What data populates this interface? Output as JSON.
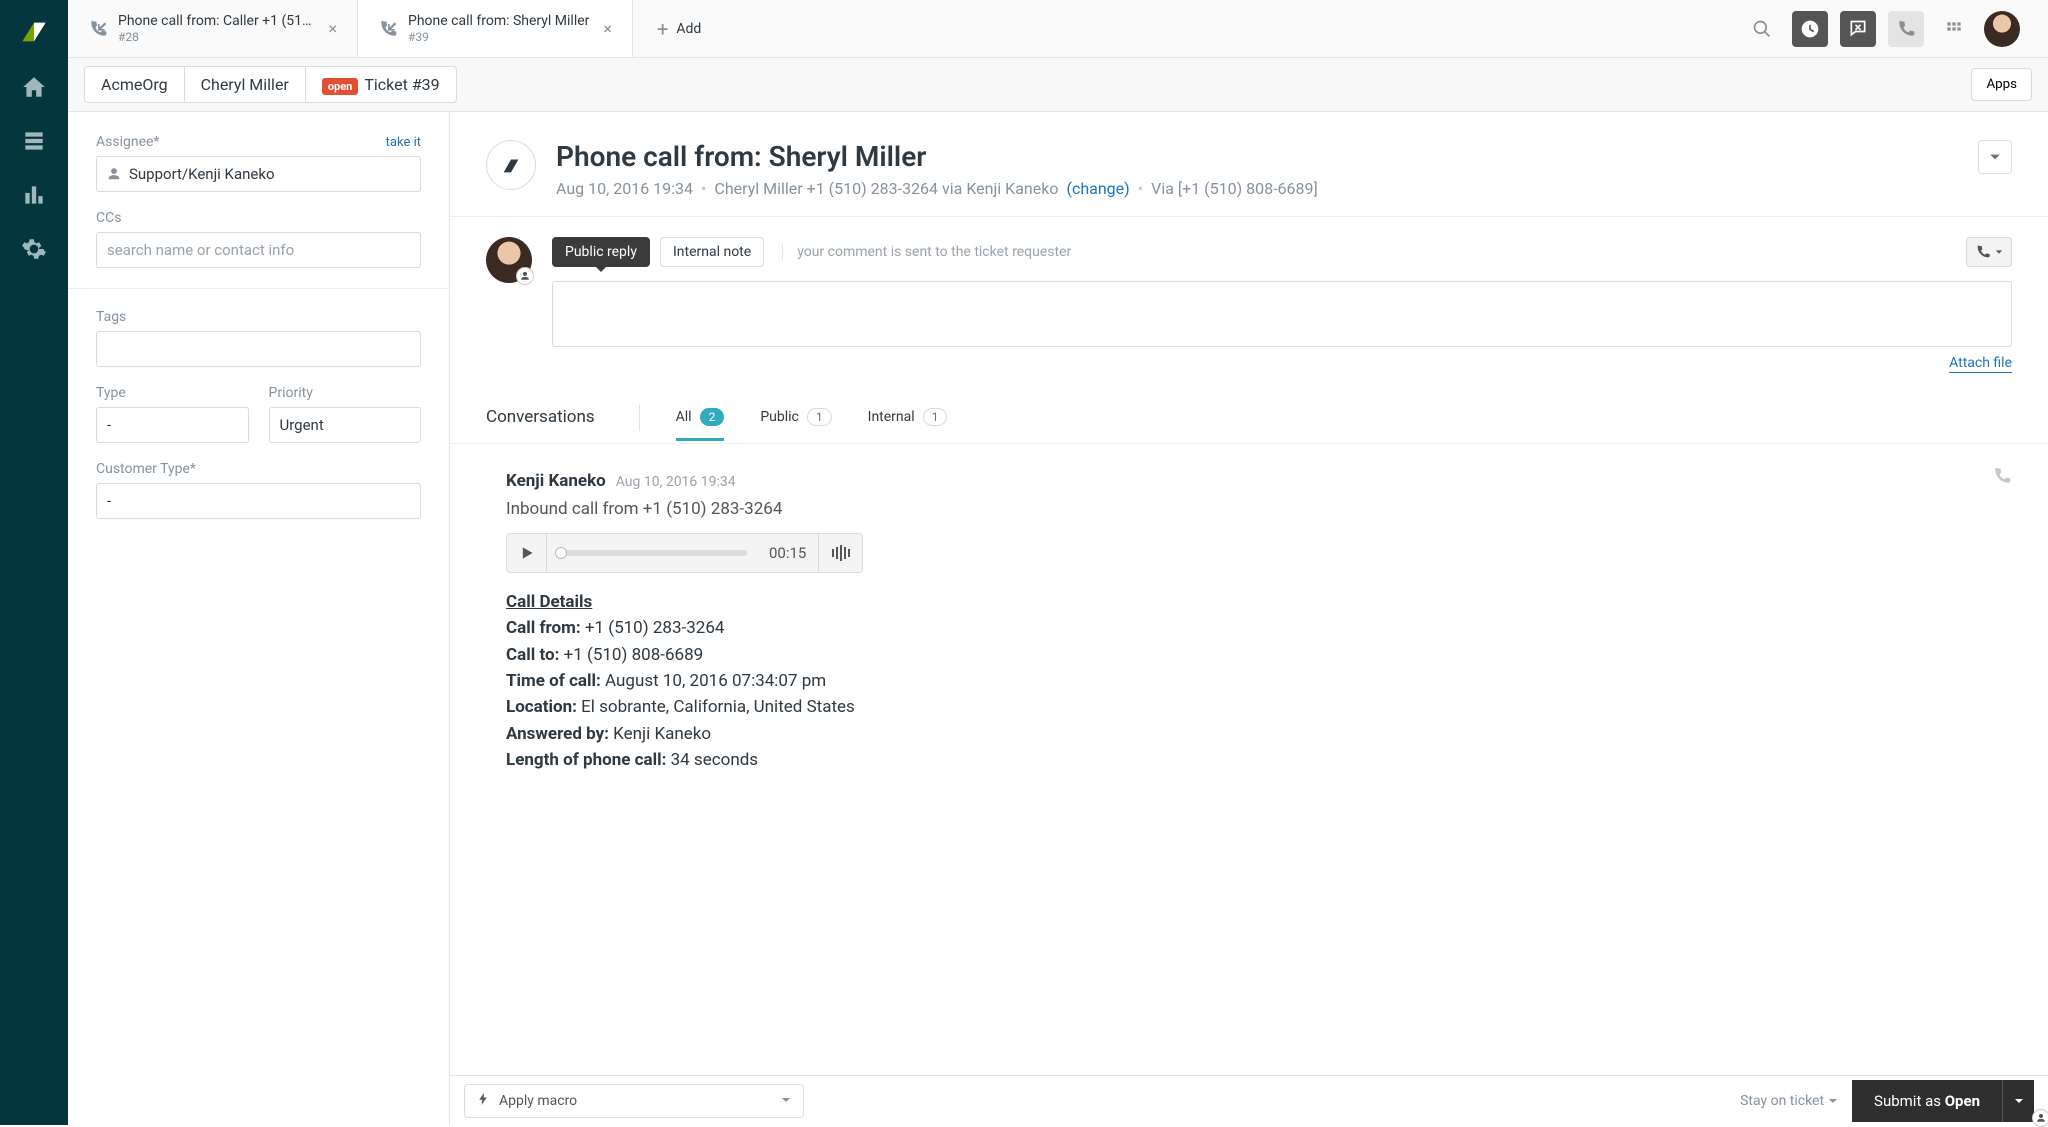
{
  "tabs": [
    {
      "title": "Phone call from: Caller +1 (510...",
      "sub": "#28"
    },
    {
      "title": "Phone call from: Sheryl Miller",
      "sub": "#39"
    }
  ],
  "add_label": "Add",
  "crumbs": {
    "org": "AcmeOrg",
    "requester": "Cheryl Miller",
    "status": "open",
    "ticket": "Ticket #39"
  },
  "apps_button": "Apps",
  "sidebar": {
    "assignee_label": "Assignee*",
    "takeit": "take it",
    "assignee_value": "Support/Kenji Kaneko",
    "ccs_label": "CCs",
    "ccs_placeholder": "search name or contact info",
    "tags_label": "Tags",
    "type_label": "Type",
    "type_value": "-",
    "priority_label": "Priority",
    "priority_value": "Urgent",
    "ctype_label": "Customer Type*",
    "ctype_value": "-"
  },
  "ticket": {
    "title": "Phone call from: Sheryl Miller",
    "timestamp": "Aug 10, 2016 19:34",
    "meta_requester": "Cheryl Miller +1 (510) 283-3264 via Kenji Kaneko",
    "change": "(change)",
    "via": "Via [+1 (510) 808-6689]"
  },
  "reply": {
    "public": "Public reply",
    "internal": "Internal note",
    "hint": "your comment is sent to the ticket requester",
    "attach": "Attach file"
  },
  "filters": {
    "conversations": "Conversations",
    "all": "All",
    "all_count": "2",
    "public": "Public",
    "public_count": "1",
    "internal": "Internal",
    "internal_count": "1"
  },
  "event": {
    "author": "Kenji Kaneko",
    "time": "Aug 10, 2016 19:34",
    "summary": "Inbound call from +1 (510) 283-3264",
    "duration": "00:15",
    "details_header": "Call Details",
    "from_label": "Call from:",
    "from_val": "+1 (510) 283-3264",
    "to_label": "Call to:",
    "to_val": "+1 (510) 808-6689",
    "timeofcall_label": "Time of call:",
    "timeofcall_val": "August 10, 2016 07:34:07 pm",
    "location_label": "Location:",
    "location_val": "El sobrante, California, United States",
    "answered_label": "Answered by:",
    "answered_val": "Kenji Kaneko",
    "length_label": "Length of phone call:",
    "length_val": "34 seconds"
  },
  "footer": {
    "macro": "Apply macro",
    "stay": "Stay on ticket",
    "submit_prefix": "Submit as ",
    "submit_status": "Open"
  }
}
